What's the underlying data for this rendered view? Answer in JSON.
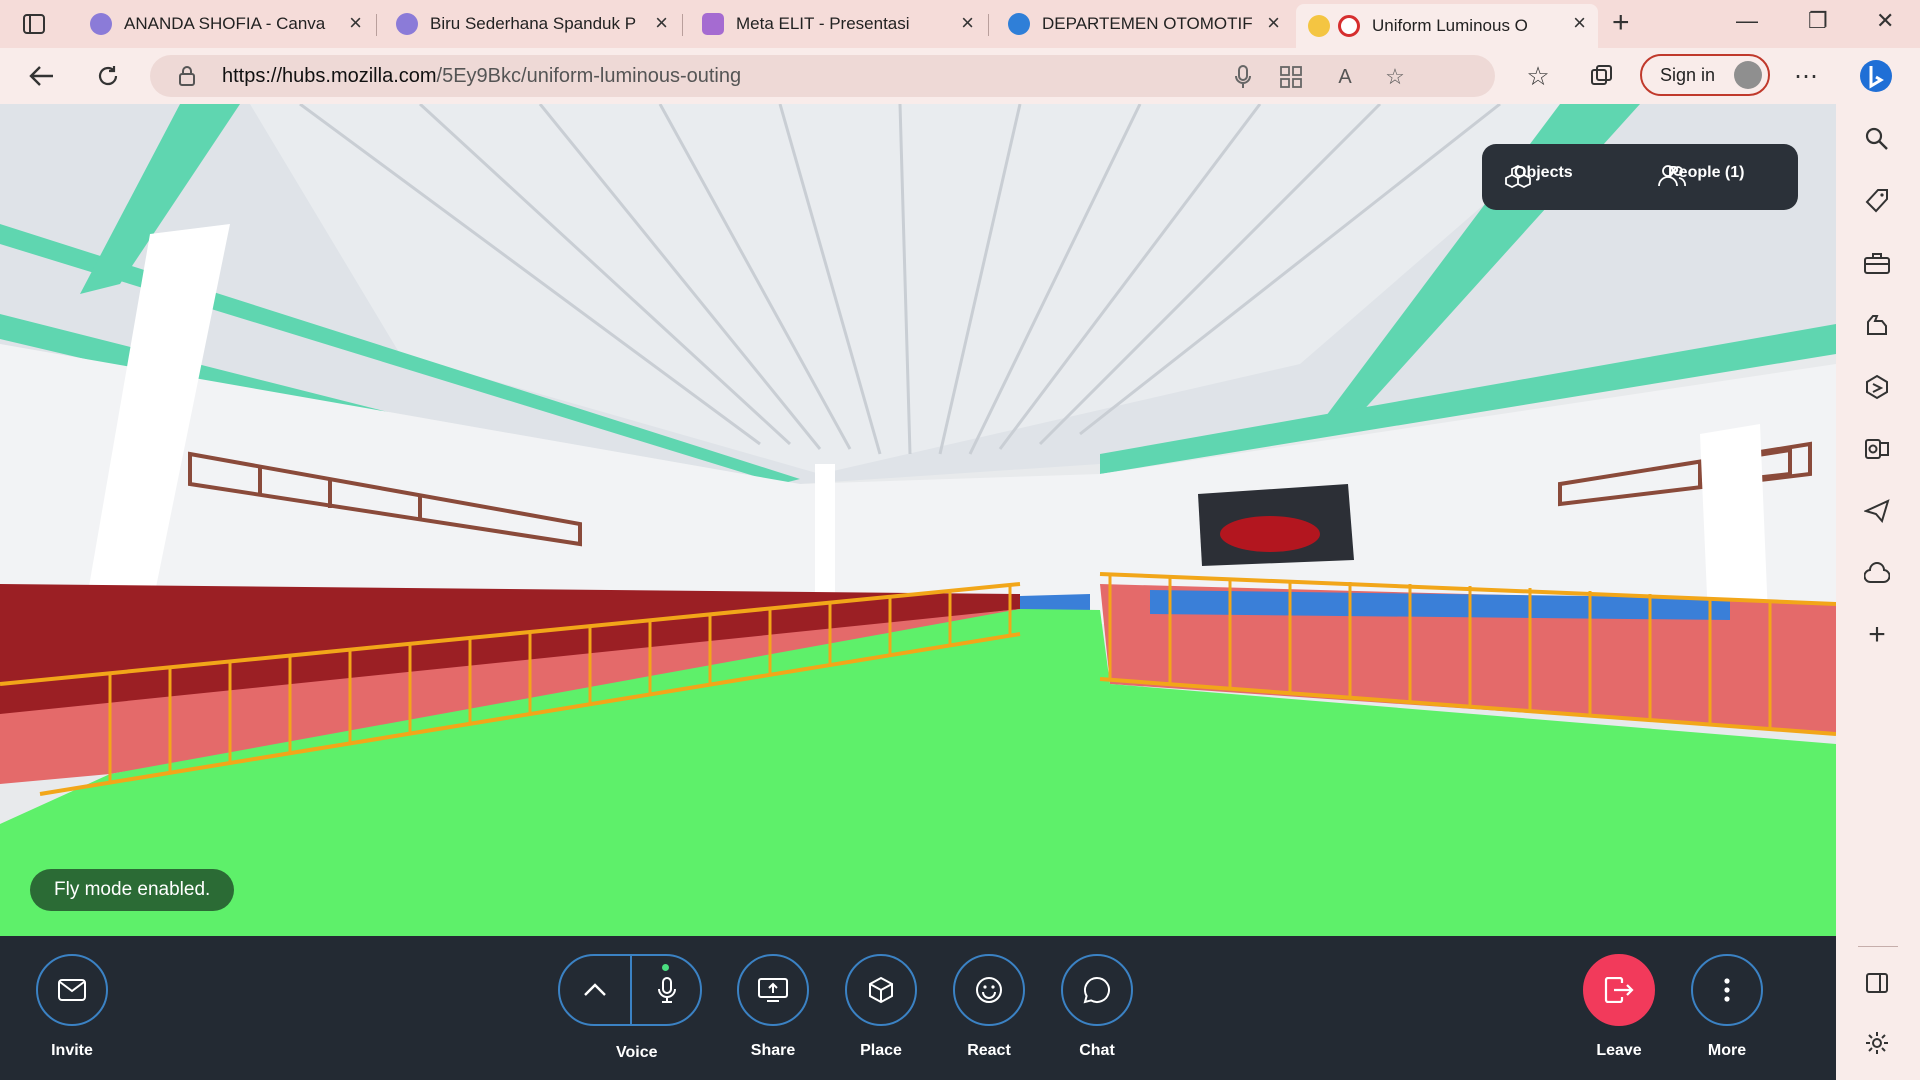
{
  "browser": {
    "tabs": [
      {
        "label": "ANANDA SHOFIA - Canva",
        "favicon": "canva-icon",
        "color": "#8b7bd8",
        "active": false
      },
      {
        "label": "Biru Sederhana Spanduk P",
        "favicon": "canva-icon",
        "color": "#8b7bd8",
        "active": false
      },
      {
        "label": "Meta ELIT - Presentasi",
        "favicon": "presentation-icon",
        "color": "#a56bd1",
        "active": false
      },
      {
        "label": "DEPARTEMEN OTOMOTIF",
        "favicon": "canva-icon",
        "color": "#2f7fd8",
        "active": false
      },
      {
        "label": "Uniform Luminous O",
        "favicon": "recording-icon",
        "color": "#d62f2f",
        "active": true
      }
    ],
    "url_host": "https://hubs.mozilla.com",
    "url_path": "/5Ey9Bkc/uniform-luminous-outing",
    "sign_in": "Sign in"
  },
  "hud": {
    "objects": "Objects",
    "people": "People (1)"
  },
  "toast": "Fly mode enabled.",
  "toolbar": {
    "invite": "Invite",
    "voice": "Voice",
    "share": "Share",
    "place": "Place",
    "react": "React",
    "chat": "Chat",
    "leave": "Leave",
    "more": "More"
  },
  "colors": {
    "floor": "#5ef06a",
    "accent_beam": "#5fd6b0",
    "fence": "#f2a619",
    "stand": "#e46a6a",
    "wall_dark": "#9b1f24",
    "leave_button": "#f23a5b"
  }
}
